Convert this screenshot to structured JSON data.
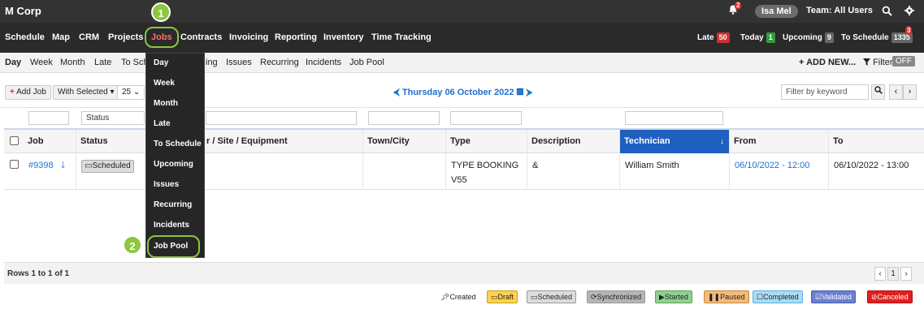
{
  "app": {
    "brand": "M Corp",
    "notif_count": "2",
    "user": "Isa Mel",
    "team": "Team: All Users"
  },
  "nav": {
    "items": [
      "Schedule",
      "Map",
      "CRM",
      "Projects",
      "Jobs",
      "Contracts",
      "Invoicing",
      "Reporting",
      "Inventory",
      "Time Tracking"
    ],
    "active": "Jobs",
    "counters": [
      {
        "label": "Late",
        "value": "50",
        "color": "#d32f2f"
      },
      {
        "label": "Today",
        "value": "1",
        "color": "#2e9e3e"
      },
      {
        "label": "Upcoming",
        "value": "9",
        "color": "#666666"
      },
      {
        "label": "To Schedule",
        "value": "1335",
        "color": "#666666"
      }
    ],
    "to_schedule_alert": "3"
  },
  "subnav": {
    "items": [
      "Day",
      "Week",
      "Month",
      "Late",
      "To Sch",
      "ing",
      "Issues",
      "Recurring",
      "Incidents",
      "Job Pool"
    ],
    "add_new": "ADD NEW...",
    "filter": "Filter",
    "filter_state": "OFF"
  },
  "toolbar": {
    "add_job": "Add Job",
    "with_selected": "With Selected",
    "page_size": "25",
    "date_label": "Thursday 06 October 2022",
    "keyword_placeholder": "Filter by keyword"
  },
  "table": {
    "status_filter": "Status",
    "columns": [
      "Job",
      "Status",
      "r / Site / Equipment",
      "Town/City",
      "Type",
      "Description",
      "Technician",
      "From",
      "To"
    ],
    "sorted_column": "Technician",
    "rows": [
      {
        "job": "#9398",
        "status": "Scheduled",
        "site": "",
        "town": "",
        "type": "TYPE BOOKING V55",
        "description": "&",
        "technician": "William Smith",
        "from": "06/10/2022 - 12:00",
        "to": "06/10/2022 - 13:00"
      }
    ],
    "rows_info": "Rows 1 to 1 of 1",
    "current_page": "1"
  },
  "legend": [
    {
      "label": "Created",
      "bg": "#ffffff",
      "border": "#ffffff",
      "color": "#222222"
    },
    {
      "label": "Draft",
      "bg": "#ffd24d",
      "border": "#c9a21a",
      "color": "#222222"
    },
    {
      "label": "Scheduled",
      "bg": "#dcdcdc",
      "border": "#999999",
      "color": "#222222"
    },
    {
      "label": "Synchronized",
      "bg": "#b5b5b5",
      "border": "#888888",
      "color": "#222222"
    },
    {
      "label": "Started",
      "bg": "#8fd18f",
      "border": "#5aa55a",
      "color": "#222222"
    },
    {
      "label": "Paused",
      "bg": "#f5b97a",
      "border": "#cc8840",
      "color": "#222222"
    },
    {
      "label": "Completed",
      "bg": "#a9dcf5",
      "border": "#5ab0db",
      "color": "#222222"
    },
    {
      "label": "Validated",
      "bg": "#6b7fd0",
      "border": "#4a5fb0",
      "color": "#ffffff"
    },
    {
      "label": "Canceled",
      "bg": "#e02020",
      "border": "#b01010",
      "color": "#ffffff"
    }
  ],
  "dropdown": {
    "items": [
      "Day",
      "Week",
      "Month",
      "Late",
      "To Schedule",
      "Upcoming",
      "Issues",
      "Recurring",
      "Incidents",
      "Job Pool"
    ]
  },
  "callouts": [
    "1",
    "2"
  ],
  "colors": {
    "accent": "#1f6fd0",
    "nav_bg": "#2a2a2a",
    "callout": "#8dc63f",
    "sorted_header": "#1f5fbf"
  }
}
